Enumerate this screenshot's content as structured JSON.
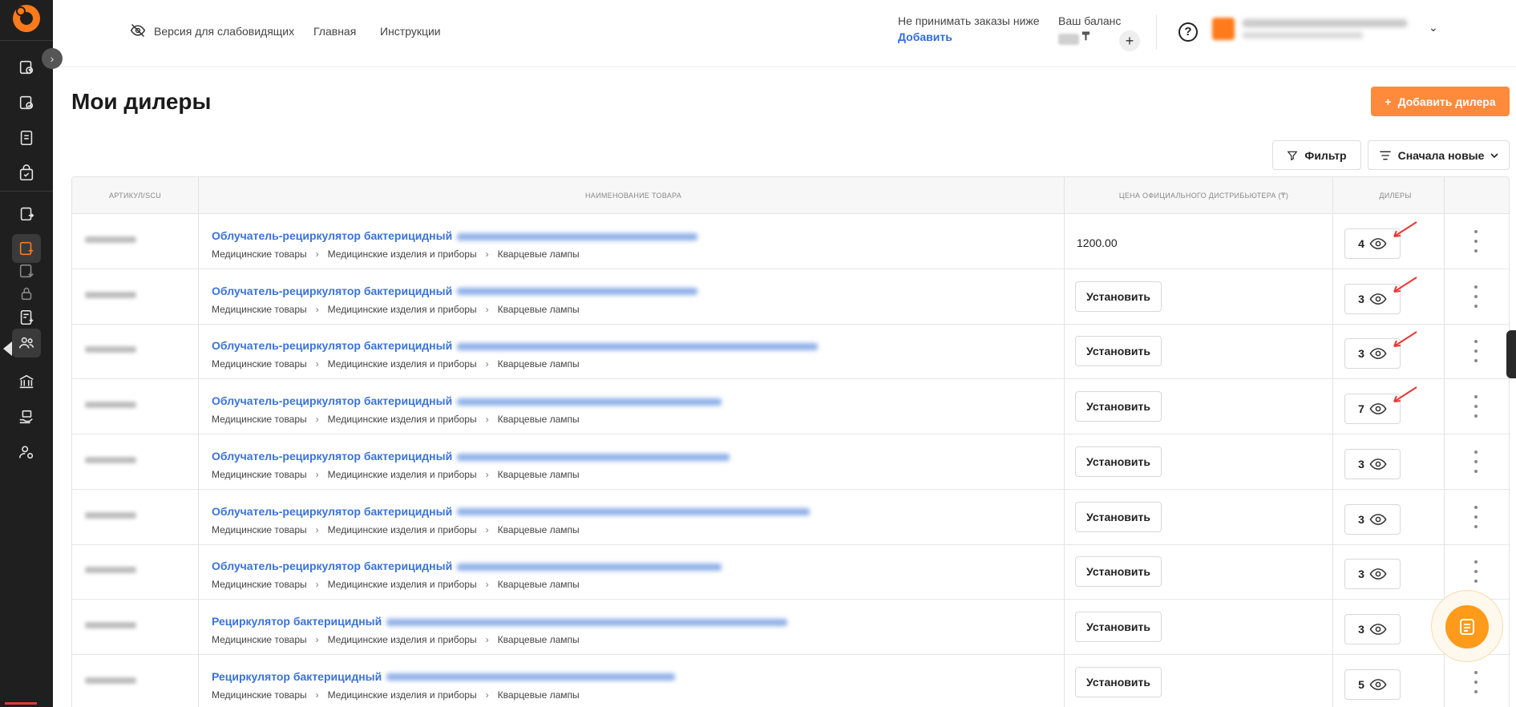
{
  "topbar": {
    "accessibility": "Версия для слабовидящих",
    "nav": [
      "Главная",
      "Инструкции"
    ],
    "orders_text": "Не принимать заказы ниже",
    "orders_link": "Добавить",
    "balance_label": "Ваш баланс",
    "balance_currency": "₸",
    "balance_add": "+",
    "help": "?",
    "user_chevron": "⌄"
  },
  "page": {
    "title": "Мои дилеры",
    "add_button": "Добавить дилера",
    "add_icon": "+",
    "filter_button": "Фильтр",
    "sort_button": "Сначала новые"
  },
  "table": {
    "headers": [
      "АРТИКУЛ/SCU",
      "НАИМЕНОВАНИЕ ТОВАРА",
      "ЦЕНА ОФИЦИАЛЬНОГО ДИСТРИБЬЮТЕРА (₸)",
      "ДИЛЕРЫ"
    ],
    "breadcrumb": [
      "Медицинские товары",
      "Медицинские изделия и приборы",
      "Кварцевые лампы"
    ],
    "set_label": "Установить",
    "rows": [
      {
        "name": "Облучатель-рециркулятор бактерицидный",
        "price": "1200.00",
        "dealers": "4",
        "arrow": true
      },
      {
        "name": "Облучатель-рециркулятор бактерицидный",
        "price": "",
        "dealers": "3",
        "arrow": true
      },
      {
        "name": "Облучатель-рециркулятор бактерицидный",
        "price": "",
        "dealers": "3",
        "arrow": true
      },
      {
        "name": "Облучатель-рециркулятор бактерицидный",
        "price": "",
        "dealers": "7",
        "arrow": true
      },
      {
        "name": "Облучатель-рециркулятор бактерицидный",
        "price": "",
        "dealers": "3",
        "arrow": false
      },
      {
        "name": "Облучатель-рециркулятор бактерицидный",
        "price": "",
        "dealers": "3",
        "arrow": false
      },
      {
        "name": "Облучатель-рециркулятор бактерицидный",
        "price": "",
        "dealers": "3",
        "arrow": false
      },
      {
        "name": "Рециркулятор бактерицидный",
        "price": "",
        "dealers": "3",
        "arrow": false
      },
      {
        "name": "Рециркулятор бактерицидный",
        "price": "",
        "dealers": "5",
        "arrow": false
      }
    ]
  },
  "colors": {
    "accent": "#ff8a3c",
    "link": "#3a73d8",
    "sidebar": "#1f1f1f",
    "annotation": "#e53935"
  },
  "icons": [
    "eye-off-icon",
    "help-icon",
    "filter-icon",
    "sort-icon",
    "eye-icon",
    "kebab-icon",
    "chat-icon"
  ]
}
